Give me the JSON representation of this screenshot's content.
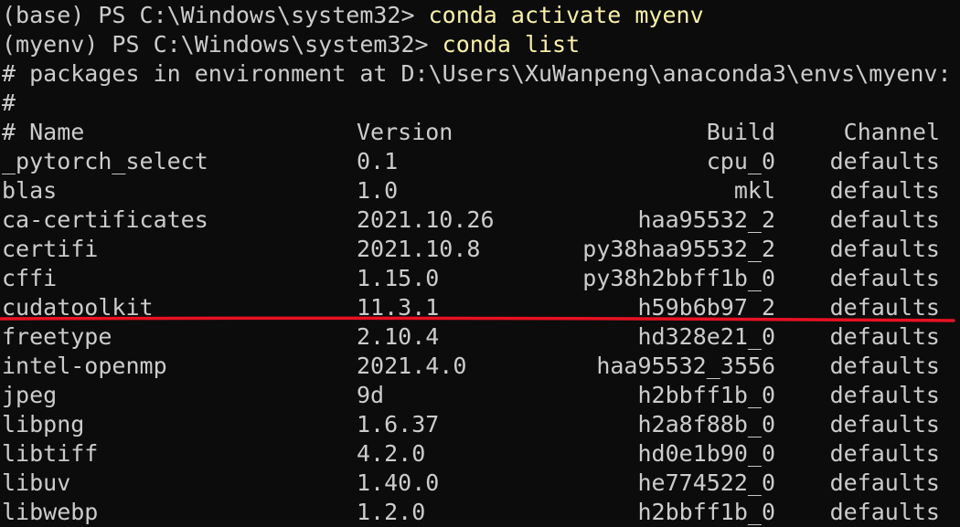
{
  "prompts": [
    {
      "prefix": "(base) PS C:\\Windows\\system32> ",
      "command": "conda activate myenv"
    },
    {
      "prefix": "(myenv) PS C:\\Windows\\system32> ",
      "command": "conda list"
    }
  ],
  "comments": [
    "# packages in environment at D:\\Users\\XuWanpeng\\anaconda3\\envs\\myenv:",
    "#"
  ],
  "header": {
    "name": "# Name",
    "version": "Version",
    "build": "Build",
    "channel": "Channel"
  },
  "packages": [
    {
      "name": "_pytorch_select",
      "version": "0.1",
      "build": "cpu_0",
      "channel": "defaults"
    },
    {
      "name": "blas",
      "version": "1.0",
      "build": "mkl",
      "channel": "defaults"
    },
    {
      "name": "ca-certificates",
      "version": "2021.10.26",
      "build": "haa95532_2",
      "channel": "defaults"
    },
    {
      "name": "certifi",
      "version": "2021.10.8",
      "build": "py38haa95532_2",
      "channel": "defaults"
    },
    {
      "name": "cffi",
      "version": "1.15.0",
      "build": "py38h2bbff1b_0",
      "channel": "defaults"
    },
    {
      "name": "cudatoolkit",
      "version": "11.3.1",
      "build": "h59b6b97_2",
      "channel": "defaults"
    },
    {
      "name": "freetype",
      "version": "2.10.4",
      "build": "hd328e21_0",
      "channel": "defaults"
    },
    {
      "name": "intel-openmp",
      "version": "2021.4.0",
      "build": "haa95532_3556",
      "channel": "defaults"
    },
    {
      "name": "jpeg",
      "version": "9d",
      "build": "h2bbff1b_0",
      "channel": "defaults"
    },
    {
      "name": "libpng",
      "version": "1.6.37",
      "build": "h2a8f88b_0",
      "channel": "defaults"
    },
    {
      "name": "libtiff",
      "version": "4.2.0",
      "build": "hd0e1b90_0",
      "channel": "defaults"
    },
    {
      "name": "libuv",
      "version": "1.40.0",
      "build": "he774522_0",
      "channel": "defaults"
    },
    {
      "name": "libwebp",
      "version": "1.2.0",
      "build": "h2bbff1b_0",
      "channel": "defaults"
    }
  ],
  "colors": {
    "background": "#0c0c0c",
    "text": "#cccccc",
    "command": "#f9f1a5",
    "annotation": "#e81123"
  }
}
